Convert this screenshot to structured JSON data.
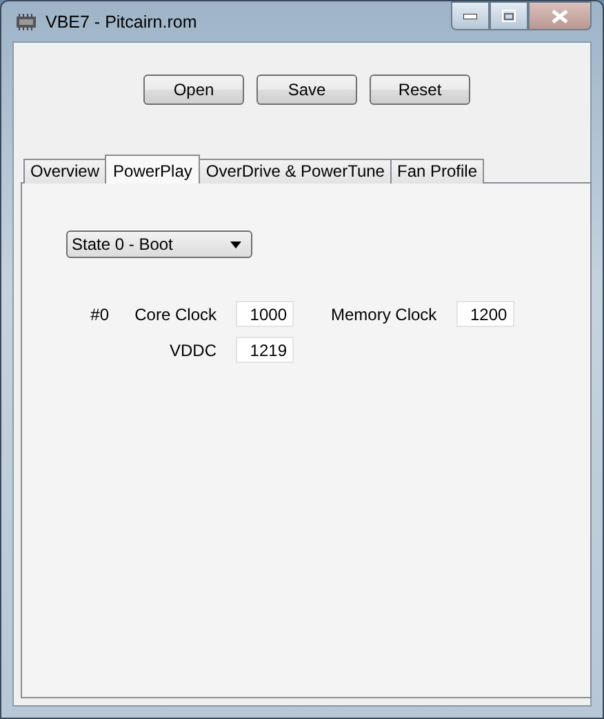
{
  "window": {
    "title": "VBE7 - Pitcairn.rom"
  },
  "buttons": [
    "Open",
    "Save",
    "Reset"
  ],
  "tabs": [
    {
      "label": "Overview",
      "selected": false
    },
    {
      "label": "PowerPlay",
      "selected": true
    },
    {
      "label": "OverDrive & PowerTune",
      "selected": false
    },
    {
      "label": "Fan Profile",
      "selected": false
    }
  ],
  "state_select": {
    "value": "State 0 - Boot"
  },
  "state": {
    "index": "#0",
    "fields": [
      {
        "label": "Core Clock",
        "value": "1000"
      },
      {
        "label": "Memory Clock",
        "value": "1200"
      },
      {
        "label": "VDDC",
        "value": "1219"
      }
    ]
  }
}
